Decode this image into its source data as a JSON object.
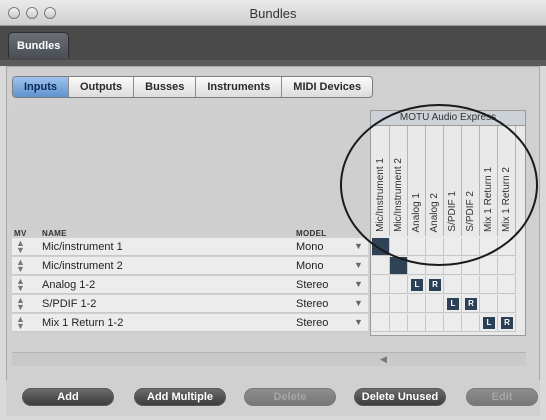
{
  "window": {
    "title": "Bundles",
    "tab": "Bundles"
  },
  "tabs": [
    {
      "label": "Inputs",
      "active": true
    },
    {
      "label": "Outputs",
      "active": false
    },
    {
      "label": "Busses",
      "active": false
    },
    {
      "label": "Instruments",
      "active": false
    },
    {
      "label": "MIDI Devices",
      "active": false
    }
  ],
  "table": {
    "headers": {
      "mv": "MV",
      "name": "NAME",
      "model": "MODEL"
    },
    "rows": [
      {
        "name": "Mic/instrument 1",
        "model": "Mono"
      },
      {
        "name": "Mic/instrument 2",
        "model": "Mono"
      },
      {
        "name": "Analog 1-2",
        "model": "Stereo"
      },
      {
        "name": "S/PDIF 1-2",
        "model": "Stereo"
      },
      {
        "name": "Mix 1 Return 1-2",
        "model": "Stereo"
      }
    ]
  },
  "matrix": {
    "device": "MOTU Audio Express",
    "columns": [
      "Mic/Instrument 1",
      "Mic/Instrument 2",
      "Analog 1",
      "Analog 2",
      "S/PDIF 1",
      "S/PDIF 2",
      "Mix 1 Return 1",
      "Mix 1 Return 2"
    ],
    "cells": [
      {
        "row": 0,
        "col": 0,
        "label": ""
      },
      {
        "row": 1,
        "col": 1,
        "label": ""
      },
      {
        "row": 2,
        "col": 2,
        "label": "L"
      },
      {
        "row": 2,
        "col": 3,
        "label": "R"
      },
      {
        "row": 3,
        "col": 4,
        "label": "L"
      },
      {
        "row": 3,
        "col": 5,
        "label": "R"
      },
      {
        "row": 4,
        "col": 6,
        "label": "L"
      },
      {
        "row": 4,
        "col": 7,
        "label": "R"
      }
    ]
  },
  "buttons": {
    "add": "Add",
    "add_multiple": "Add Multiple",
    "delete": "Delete",
    "delete_unused": "Delete Unused",
    "edit": "Edit"
  },
  "colors": {
    "accent": "#5f92d0",
    "assign": "#2b3f57"
  }
}
